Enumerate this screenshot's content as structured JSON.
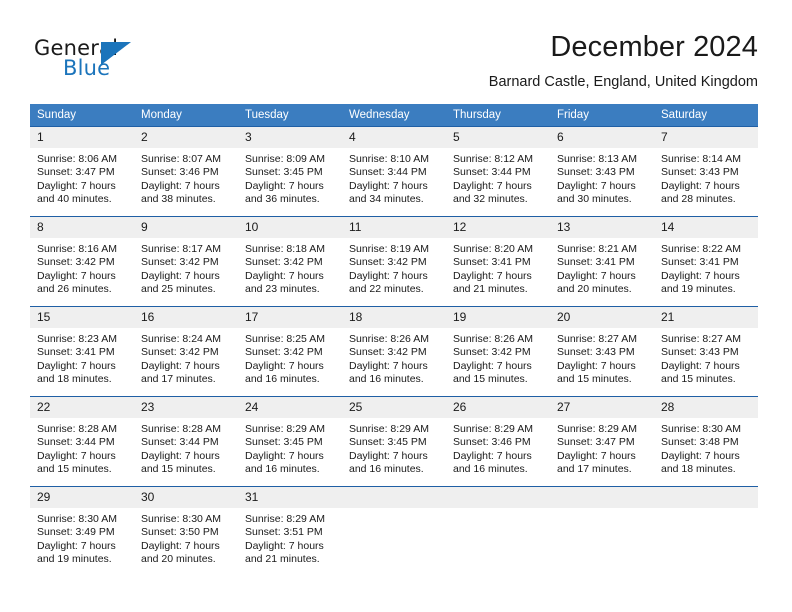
{
  "brand": {
    "name_part1": "General",
    "name_part2": "Blue",
    "triangle_icon": "triangle-icon",
    "accent_color": "#1b74bb"
  },
  "header": {
    "title": "December 2024",
    "location": "Barnard Castle, England, United Kingdom"
  },
  "theme": {
    "header_row_bg": "#3b7dc0",
    "row_divider": "#1f5fa5",
    "daynum_bg": "#efefef",
    "text": "#1a1a1a"
  },
  "weekday_headers": [
    "Sunday",
    "Monday",
    "Tuesday",
    "Wednesday",
    "Thursday",
    "Friday",
    "Saturday"
  ],
  "weeks": [
    [
      {
        "day": "1",
        "sunrise": "Sunrise: 8:06 AM",
        "sunset": "Sunset: 3:47 PM",
        "daylight": "Daylight: 7 hours and 40 minutes.",
        "details": "Sunrise: 8:06 AM\nSunset: 3:47 PM\nDaylight: 7 hours\nand 40 minutes."
      },
      {
        "day": "2",
        "sunrise": "Sunrise: 8:07 AM",
        "sunset": "Sunset: 3:46 PM",
        "daylight": "Daylight: 7 hours and 38 minutes.",
        "details": "Sunrise: 8:07 AM\nSunset: 3:46 PM\nDaylight: 7 hours\nand 38 minutes."
      },
      {
        "day": "3",
        "sunrise": "Sunrise: 8:09 AM",
        "sunset": "Sunset: 3:45 PM",
        "daylight": "Daylight: 7 hours and 36 minutes.",
        "details": "Sunrise: 8:09 AM\nSunset: 3:45 PM\nDaylight: 7 hours\nand 36 minutes."
      },
      {
        "day": "4",
        "sunrise": "Sunrise: 8:10 AM",
        "sunset": "Sunset: 3:44 PM",
        "daylight": "Daylight: 7 hours and 34 minutes.",
        "details": "Sunrise: 8:10 AM\nSunset: 3:44 PM\nDaylight: 7 hours\nand 34 minutes."
      },
      {
        "day": "5",
        "sunrise": "Sunrise: 8:12 AM",
        "sunset": "Sunset: 3:44 PM",
        "daylight": "Daylight: 7 hours and 32 minutes.",
        "details": "Sunrise: 8:12 AM\nSunset: 3:44 PM\nDaylight: 7 hours\nand 32 minutes."
      },
      {
        "day": "6",
        "sunrise": "Sunrise: 8:13 AM",
        "sunset": "Sunset: 3:43 PM",
        "daylight": "Daylight: 7 hours and 30 minutes.",
        "details": "Sunrise: 8:13 AM\nSunset: 3:43 PM\nDaylight: 7 hours\nand 30 minutes."
      },
      {
        "day": "7",
        "sunrise": "Sunrise: 8:14 AM",
        "sunset": "Sunset: 3:43 PM",
        "daylight": "Daylight: 7 hours and 28 minutes.",
        "details": "Sunrise: 8:14 AM\nSunset: 3:43 PM\nDaylight: 7 hours\nand 28 minutes."
      }
    ],
    [
      {
        "day": "8",
        "sunrise": "Sunrise: 8:16 AM",
        "sunset": "Sunset: 3:42 PM",
        "daylight": "Daylight: 7 hours and 26 minutes.",
        "details": "Sunrise: 8:16 AM\nSunset: 3:42 PM\nDaylight: 7 hours\nand 26 minutes."
      },
      {
        "day": "9",
        "sunrise": "Sunrise: 8:17 AM",
        "sunset": "Sunset: 3:42 PM",
        "daylight": "Daylight: 7 hours and 25 minutes.",
        "details": "Sunrise: 8:17 AM\nSunset: 3:42 PM\nDaylight: 7 hours\nand 25 minutes."
      },
      {
        "day": "10",
        "sunrise": "Sunrise: 8:18 AM",
        "sunset": "Sunset: 3:42 PM",
        "daylight": "Daylight: 7 hours and 23 minutes.",
        "details": "Sunrise: 8:18 AM\nSunset: 3:42 PM\nDaylight: 7 hours\nand 23 minutes."
      },
      {
        "day": "11",
        "sunrise": "Sunrise: 8:19 AM",
        "sunset": "Sunset: 3:42 PM",
        "daylight": "Daylight: 7 hours and 22 minutes.",
        "details": "Sunrise: 8:19 AM\nSunset: 3:42 PM\nDaylight: 7 hours\nand 22 minutes."
      },
      {
        "day": "12",
        "sunrise": "Sunrise: 8:20 AM",
        "sunset": "Sunset: 3:41 PM",
        "daylight": "Daylight: 7 hours and 21 minutes.",
        "details": "Sunrise: 8:20 AM\nSunset: 3:41 PM\nDaylight: 7 hours\nand 21 minutes."
      },
      {
        "day": "13",
        "sunrise": "Sunrise: 8:21 AM",
        "sunset": "Sunset: 3:41 PM",
        "daylight": "Daylight: 7 hours and 20 minutes.",
        "details": "Sunrise: 8:21 AM\nSunset: 3:41 PM\nDaylight: 7 hours\nand 20 minutes."
      },
      {
        "day": "14",
        "sunrise": "Sunrise: 8:22 AM",
        "sunset": "Sunset: 3:41 PM",
        "daylight": "Daylight: 7 hours and 19 minutes.",
        "details": "Sunrise: 8:22 AM\nSunset: 3:41 PM\nDaylight: 7 hours\nand 19 minutes."
      }
    ],
    [
      {
        "day": "15",
        "sunrise": "Sunrise: 8:23 AM",
        "sunset": "Sunset: 3:41 PM",
        "daylight": "Daylight: 7 hours and 18 minutes.",
        "details": "Sunrise: 8:23 AM\nSunset: 3:41 PM\nDaylight: 7 hours\nand 18 minutes."
      },
      {
        "day": "16",
        "sunrise": "Sunrise: 8:24 AM",
        "sunset": "Sunset: 3:42 PM",
        "daylight": "Daylight: 7 hours and 17 minutes.",
        "details": "Sunrise: 8:24 AM\nSunset: 3:42 PM\nDaylight: 7 hours\nand 17 minutes."
      },
      {
        "day": "17",
        "sunrise": "Sunrise: 8:25 AM",
        "sunset": "Sunset: 3:42 PM",
        "daylight": "Daylight: 7 hours and 16 minutes.",
        "details": "Sunrise: 8:25 AM\nSunset: 3:42 PM\nDaylight: 7 hours\nand 16 minutes."
      },
      {
        "day": "18",
        "sunrise": "Sunrise: 8:26 AM",
        "sunset": "Sunset: 3:42 PM",
        "daylight": "Daylight: 7 hours and 16 minutes.",
        "details": "Sunrise: 8:26 AM\nSunset: 3:42 PM\nDaylight: 7 hours\nand 16 minutes."
      },
      {
        "day": "19",
        "sunrise": "Sunrise: 8:26 AM",
        "sunset": "Sunset: 3:42 PM",
        "daylight": "Daylight: 7 hours and 15 minutes.",
        "details": "Sunrise: 8:26 AM\nSunset: 3:42 PM\nDaylight: 7 hours\nand 15 minutes."
      },
      {
        "day": "20",
        "sunrise": "Sunrise: 8:27 AM",
        "sunset": "Sunset: 3:43 PM",
        "daylight": "Daylight: 7 hours and 15 minutes.",
        "details": "Sunrise: 8:27 AM\nSunset: 3:43 PM\nDaylight: 7 hours\nand 15 minutes."
      },
      {
        "day": "21",
        "sunrise": "Sunrise: 8:27 AM",
        "sunset": "Sunset: 3:43 PM",
        "daylight": "Daylight: 7 hours and 15 minutes.",
        "details": "Sunrise: 8:27 AM\nSunset: 3:43 PM\nDaylight: 7 hours\nand 15 minutes."
      }
    ],
    [
      {
        "day": "22",
        "sunrise": "Sunrise: 8:28 AM",
        "sunset": "Sunset: 3:44 PM",
        "daylight": "Daylight: 7 hours and 15 minutes.",
        "details": "Sunrise: 8:28 AM\nSunset: 3:44 PM\nDaylight: 7 hours\nand 15 minutes."
      },
      {
        "day": "23",
        "sunrise": "Sunrise: 8:28 AM",
        "sunset": "Sunset: 3:44 PM",
        "daylight": "Daylight: 7 hours and 15 minutes.",
        "details": "Sunrise: 8:28 AM\nSunset: 3:44 PM\nDaylight: 7 hours\nand 15 minutes."
      },
      {
        "day": "24",
        "sunrise": "Sunrise: 8:29 AM",
        "sunset": "Sunset: 3:45 PM",
        "daylight": "Daylight: 7 hours and 16 minutes.",
        "details": "Sunrise: 8:29 AM\nSunset: 3:45 PM\nDaylight: 7 hours\nand 16 minutes."
      },
      {
        "day": "25",
        "sunrise": "Sunrise: 8:29 AM",
        "sunset": "Sunset: 3:45 PM",
        "daylight": "Daylight: 7 hours and 16 minutes.",
        "details": "Sunrise: 8:29 AM\nSunset: 3:45 PM\nDaylight: 7 hours\nand 16 minutes."
      },
      {
        "day": "26",
        "sunrise": "Sunrise: 8:29 AM",
        "sunset": "Sunset: 3:46 PM",
        "daylight": "Daylight: 7 hours and 16 minutes.",
        "details": "Sunrise: 8:29 AM\nSunset: 3:46 PM\nDaylight: 7 hours\nand 16 minutes."
      },
      {
        "day": "27",
        "sunrise": "Sunrise: 8:29 AM",
        "sunset": "Sunset: 3:47 PM",
        "daylight": "Daylight: 7 hours and 17 minutes.",
        "details": "Sunrise: 8:29 AM\nSunset: 3:47 PM\nDaylight: 7 hours\nand 17 minutes."
      },
      {
        "day": "28",
        "sunrise": "Sunrise: 8:30 AM",
        "sunset": "Sunset: 3:48 PM",
        "daylight": "Daylight: 7 hours and 18 minutes.",
        "details": "Sunrise: 8:30 AM\nSunset: 3:48 PM\nDaylight: 7 hours\nand 18 minutes."
      }
    ],
    [
      {
        "day": "29",
        "sunrise": "Sunrise: 8:30 AM",
        "sunset": "Sunset: 3:49 PM",
        "daylight": "Daylight: 7 hours and 19 minutes.",
        "details": "Sunrise: 8:30 AM\nSunset: 3:49 PM\nDaylight: 7 hours\nand 19 minutes."
      },
      {
        "day": "30",
        "sunrise": "Sunrise: 8:30 AM",
        "sunset": "Sunset: 3:50 PM",
        "daylight": "Daylight: 7 hours and 20 minutes.",
        "details": "Sunrise: 8:30 AM\nSunset: 3:50 PM\nDaylight: 7 hours\nand 20 minutes."
      },
      {
        "day": "31",
        "sunrise": "Sunrise: 8:29 AM",
        "sunset": "Sunset: 3:51 PM",
        "daylight": "Daylight: 7 hours and 21 minutes.",
        "details": "Sunrise: 8:29 AM\nSunset: 3:51 PM\nDaylight: 7 hours\nand 21 minutes."
      },
      {
        "day": "",
        "details": ""
      },
      {
        "day": "",
        "details": ""
      },
      {
        "day": "",
        "details": ""
      },
      {
        "day": "",
        "details": ""
      }
    ]
  ]
}
